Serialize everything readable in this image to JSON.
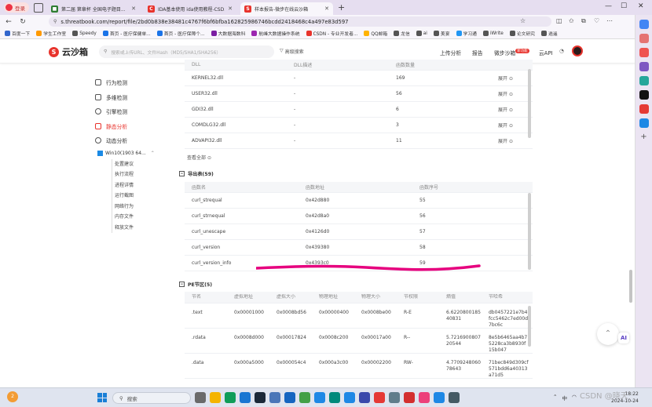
{
  "browser": {
    "profile_label": "登录",
    "tabs": [
      {
        "title": "第二届 第章杯 全国电子题目...",
        "favicon_color": "#2e7d32",
        "favicon_char": "■",
        "active": false
      },
      {
        "title": "IDA基本使用 ida使用教程-CSD...",
        "favicon_color": "#e8332c",
        "favicon_char": "C",
        "active": false
      },
      {
        "title": "样本报告-微步在线云沙箱",
        "favicon_color": "#e8332c",
        "favicon_char": "S",
        "active": true
      }
    ],
    "new_tab": "+",
    "url": "s.threatbook.com/report/file/2bd0b838e38481c4767f6bf6bfba162825986746bcdd2418468c4a497e83d597",
    "bookmarks": [
      {
        "label": "百度一下",
        "color": "#3366cc"
      },
      {
        "label": "学生工作室",
        "color": "#ff9900"
      },
      {
        "label": "Speedy",
        "color": "#555555"
      },
      {
        "label": "首页 - 医疗保健单...",
        "color": "#1a73e8"
      },
      {
        "label": "首页 - 医疗保障个...",
        "color": "#1a73e8"
      },
      {
        "label": "大数据海数科",
        "color": "#7b1fa2"
      },
      {
        "label": "航峰大数据操作系统",
        "color": "#9c27b0"
      },
      {
        "label": "CSDN - 专业开发者...",
        "color": "#e8332c"
      },
      {
        "label": "QQ邮箱",
        "color": "#ffb300"
      },
      {
        "label": "龙信",
        "color": "#555555"
      },
      {
        "label": "ai",
        "color": "#555555"
      },
      {
        "label": "美宴",
        "color": "#555555"
      },
      {
        "label": "学习通",
        "color": "#2196f3"
      },
      {
        "label": "iWrite",
        "color": "#555555"
      },
      {
        "label": "论文研究",
        "color": "#555555"
      },
      {
        "label": "逍遥",
        "color": "#555555"
      }
    ]
  },
  "site": {
    "logo_text": "云沙箱",
    "search_placeholder": "搜索或上传URL、文件Hash（MD5/SHA1/SHA256）",
    "advanced_search": "高级搜索",
    "nav": {
      "upload": "上传分析",
      "report": "报告",
      "weibu": "微步沙箱",
      "weibu_badge": "新功能",
      "api": "云API"
    }
  },
  "sidebar": {
    "items": [
      {
        "label": "行为检测",
        "active": false
      },
      {
        "label": "多维检测",
        "active": false
      },
      {
        "label": "引擎检测",
        "active": false
      },
      {
        "label": "静态分析",
        "active": true
      },
      {
        "label": "动态分析",
        "active": false
      }
    ],
    "env": "Win10(1903 64...",
    "sub_items": [
      "处置建议",
      "执行流程",
      "进程详情",
      "运行截图",
      "网络行为",
      "内存文件",
      "释放文件"
    ]
  },
  "imports": {
    "headers": [
      "DLL",
      "DLL描述",
      "函数数量",
      ""
    ],
    "rows": [
      {
        "dll": "KERNEL32.dll",
        "desc": "-",
        "count": "169",
        "action": "展开"
      },
      {
        "dll": "USER32.dll",
        "desc": "-",
        "count": "56",
        "action": "展开"
      },
      {
        "dll": "GDI32.dll",
        "desc": "-",
        "count": "6",
        "action": "展开"
      },
      {
        "dll": "COMDLG32.dll",
        "desc": "-",
        "count": "3",
        "action": "展开"
      },
      {
        "dll": "ADVAPI32.dll",
        "desc": "-",
        "count": "11",
        "action": "展开"
      }
    ],
    "view_all": "查看全部"
  },
  "exports": {
    "title": "导出表(59)",
    "headers": [
      "函数名",
      "函数地址",
      "函数序号"
    ],
    "rows": [
      {
        "name": "curl_strequal",
        "addr": "0x42d880",
        "ord": "55"
      },
      {
        "name": "curl_strnequal",
        "addr": "0x42d8a0",
        "ord": "56"
      },
      {
        "name": "curl_unescape",
        "addr": "0x4126d0",
        "ord": "57"
      },
      {
        "name": "curl_version",
        "addr": "0x439380",
        "ord": "58"
      },
      {
        "name": "curl_version_info",
        "addr": "0x4393c0",
        "ord": "59"
      }
    ]
  },
  "pe_sections": {
    "title": "PE节区(5)",
    "headers": [
      "节名",
      "虚拟地址",
      "虚拟大小",
      "物理地址",
      "物理大小",
      "节权限",
      "熵值",
      "节哈希"
    ],
    "rows": [
      {
        "name": ".text",
        "vaddr": "0x00001000",
        "vsize": "0x0008bd56",
        "paddr": "0x00000400",
        "psize": "0x0008be00",
        "perm": "R-E",
        "entropy": "6.622080018540831",
        "hash": "db0457221e7b4fcc5462c7ed00d7bc6c"
      },
      {
        "name": ".rdata",
        "vaddr": "0x0008d000",
        "vsize": "0x00017824",
        "paddr": "0x0008c200",
        "psize": "0x00017a00",
        "perm": "R--",
        "entropy": "5.721690080720544",
        "hash": "8e5b6465aa4b75228ca3b8930f15b047"
      },
      {
        "name": ".data",
        "vaddr": "0x000a5000",
        "vsize": "0x000054c4",
        "paddr": "0x000a3c00",
        "psize": "0x00002200",
        "perm": "RW-",
        "entropy": "4.770924806078643",
        "hash": "71bec849d309cf571bdd6a40313a71d5"
      }
    ]
  },
  "taskbar": {
    "weather_badge": "2",
    "search_placeholder": "搜索",
    "lang": "中",
    "time": "18:22",
    "date": "2024-10-24"
  },
  "watermark": "CSDN @晓天",
  "colors": {
    "accent": "#e8332c",
    "annotation": "#e6007e"
  }
}
